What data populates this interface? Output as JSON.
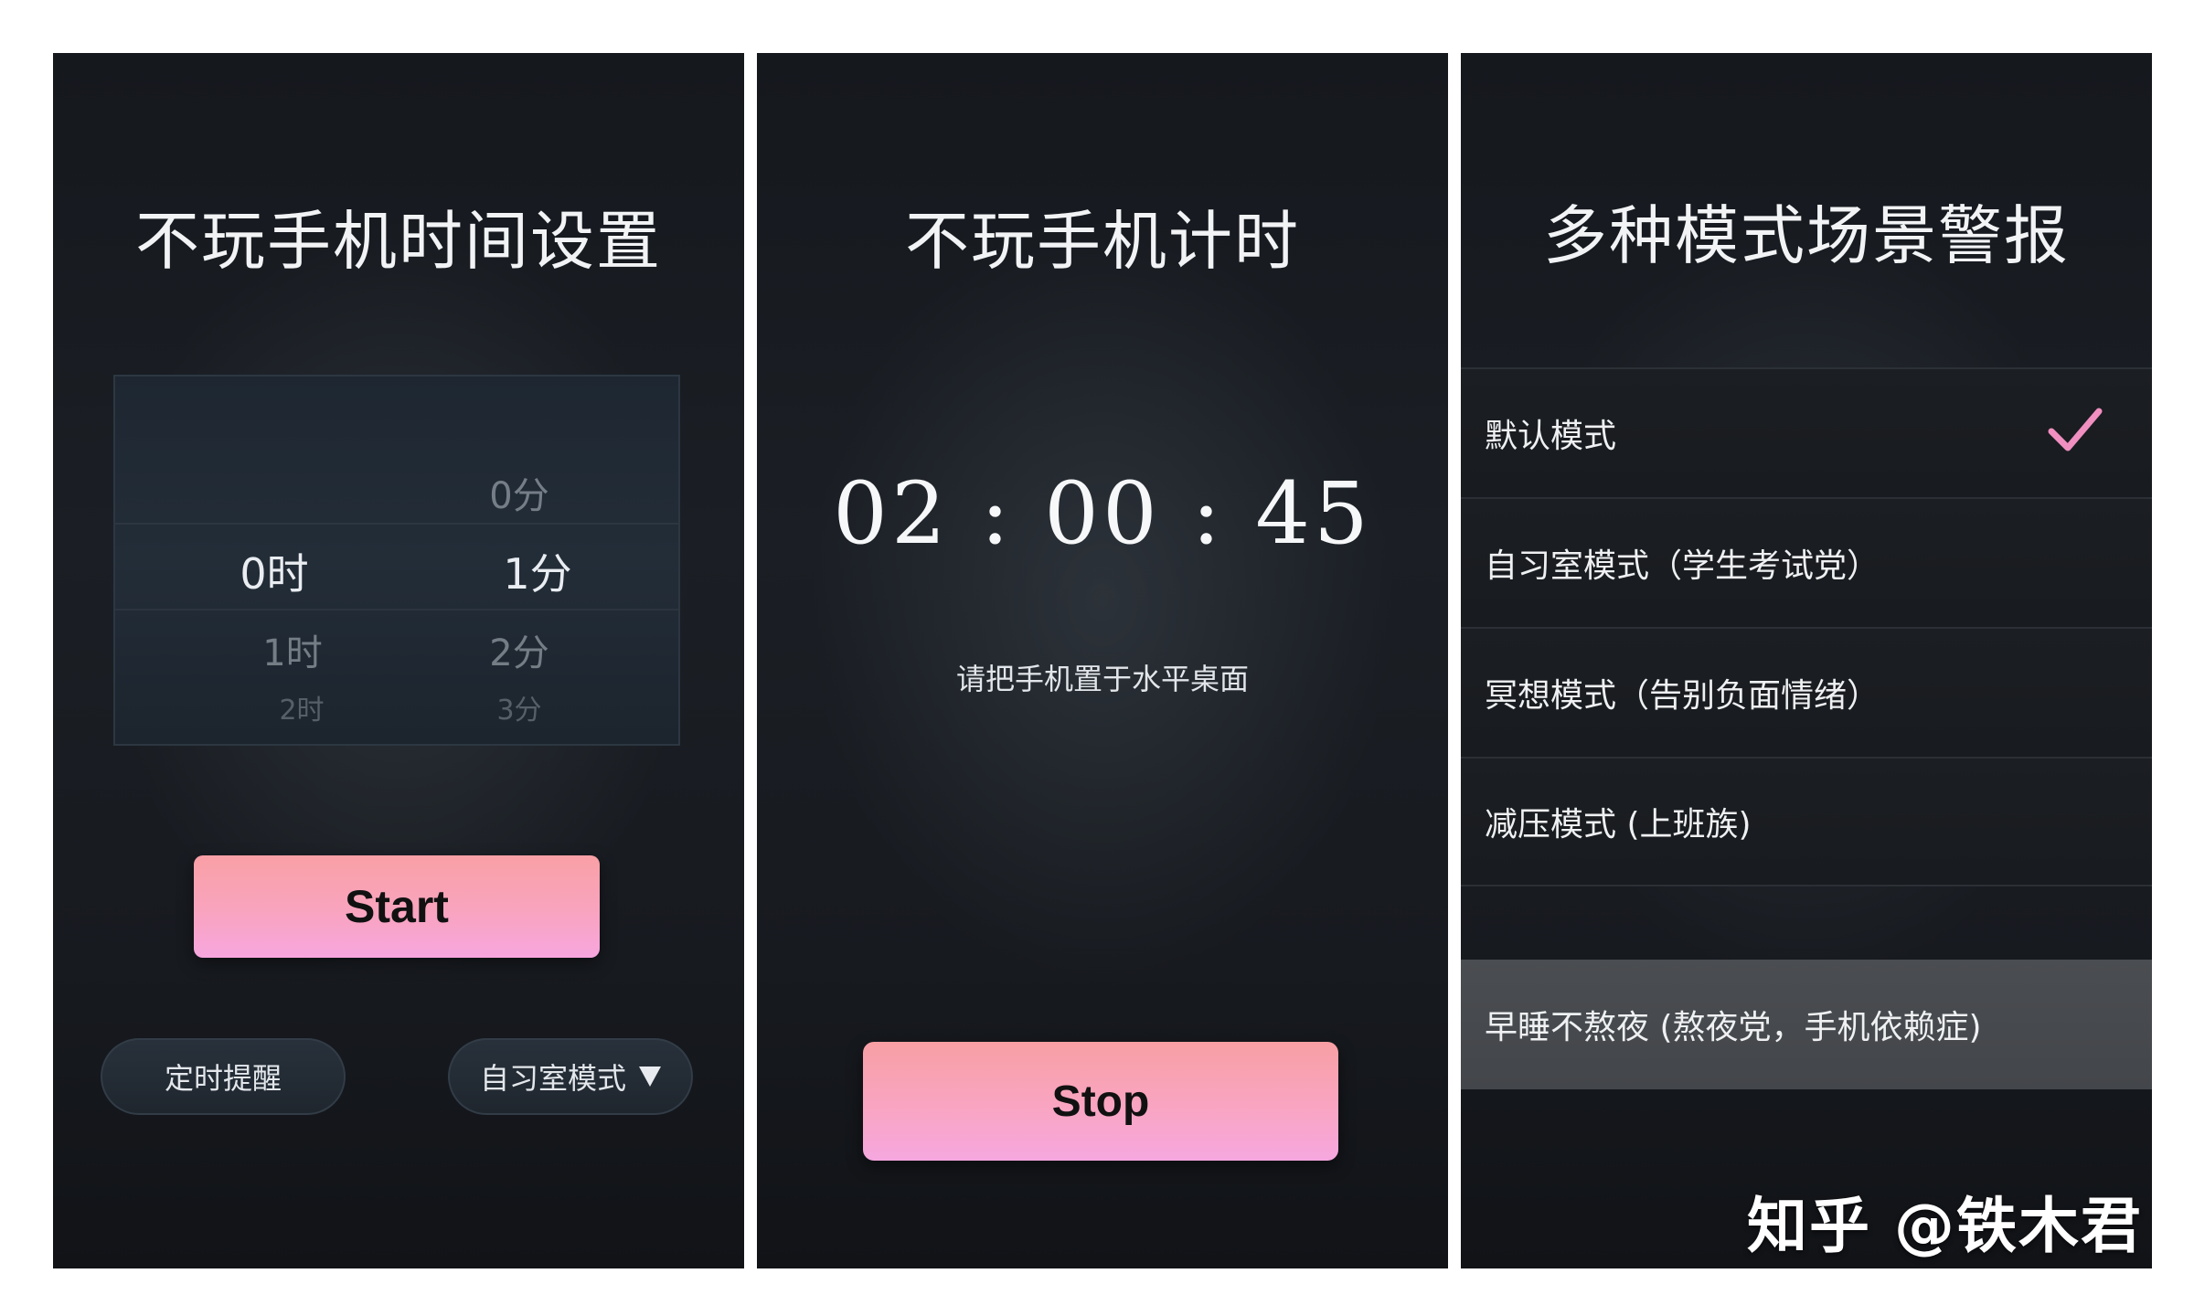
{
  "panel1": {
    "title": "不玩手机时间设置",
    "picker": {
      "minute_above": "0分",
      "hour_selected": "0时",
      "minute_selected": "1分",
      "hour_next": "1时",
      "minute_next": "2分",
      "hour_next2": "2时",
      "minute_next2": "3分"
    },
    "start_label": "Start",
    "reminder_label": "定时提醒",
    "mode_select_label": "自习室模式"
  },
  "panel2": {
    "title": "不玩手机计时",
    "timer": "02 : 00 : 45",
    "hint": "请把手机置于水平桌面",
    "stop_label": "Stop"
  },
  "panel3": {
    "title": "多种模式场景警报",
    "modes": [
      {
        "label": "默认模式",
        "selected": true
      },
      {
        "label": "自习室模式（学生考试党）",
        "selected": false
      },
      {
        "label": "冥想模式（告别负面情绪）",
        "selected": false
      },
      {
        "label": "减压模式 (上班族)",
        "selected": false
      },
      {
        "label": "早睡不熬夜 (熬夜党，手机依赖症)",
        "selected": false
      }
    ],
    "check_color": "#f08fc0"
  },
  "watermark": "知乎 @铁木君"
}
